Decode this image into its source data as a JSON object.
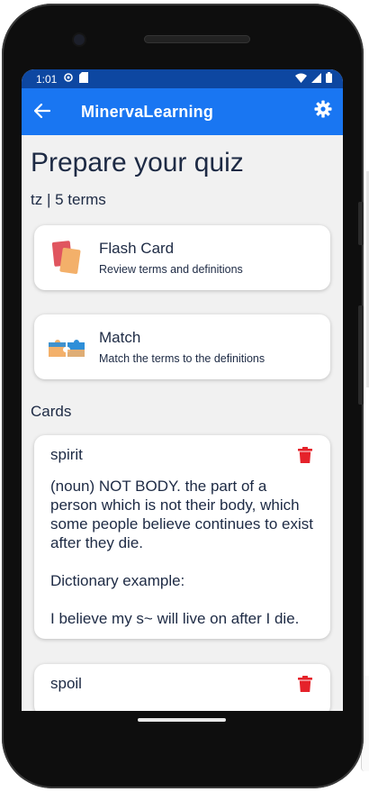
{
  "status_bar": {
    "time": "1:01",
    "icons_left": [
      "settings-sync-icon",
      "sd-card-icon"
    ],
    "icons_right": [
      "wifi-icon",
      "signal-icon",
      "battery-icon"
    ]
  },
  "app_bar": {
    "title": "MinervaLearning",
    "back_icon": "arrow-left-icon",
    "settings_icon": "gear-icon"
  },
  "page": {
    "title": "Prepare your quiz",
    "subtitle": "tz | 5 terms"
  },
  "modes": [
    {
      "name": "Flash Card",
      "description": "Review terms and definitions",
      "icon": "flash-card-icon"
    },
    {
      "name": "Match",
      "description": "Match the terms to the definitions",
      "icon": "puzzle-match-icon"
    }
  ],
  "cards_section": {
    "label": "Cards"
  },
  "cards": [
    {
      "term": "spirit",
      "definition": "(noun) NOT BODY. the part of a person which is not their body, which some people believe continues to exist after they die.\n\nDictionary example:\n\nI believe my s~ will live on after I die."
    },
    {
      "term": "spoil",
      "definition": ""
    }
  ],
  "colors": {
    "status_bar": "#0d47a1",
    "app_bar": "#1976f2",
    "background": "#f1f1f1",
    "text": "#1d2a44",
    "delete": "#e5222a"
  }
}
